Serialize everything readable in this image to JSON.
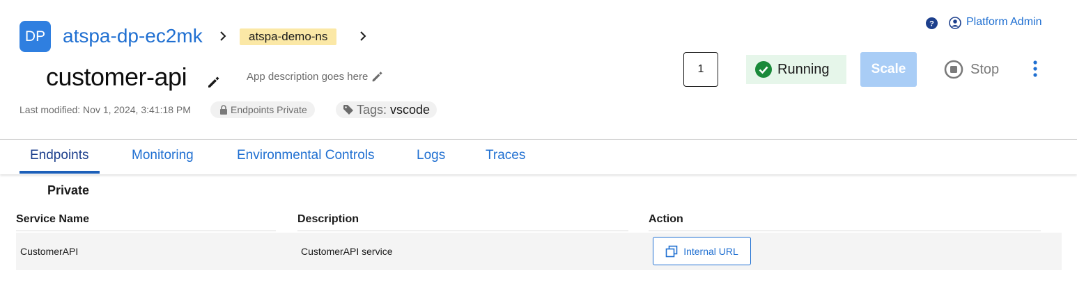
{
  "header": {
    "logo_text": "DP",
    "project_name": "atspa-dp-ec2mk",
    "namespace": "atspa-demo-ns",
    "app_name": "customer-api",
    "app_description": "App description goes here",
    "last_modified": "Last modified: Nov 1, 2024, 3:41:18 PM",
    "endpoints_visibility": "Endpoints Private",
    "tags_label": "Tags:",
    "tags_value": "vscode"
  },
  "user": {
    "name": "Platform Admin"
  },
  "controls": {
    "replicas": "1",
    "status": "Running",
    "scale_label": "Scale",
    "stop_label": "Stop"
  },
  "tabs": [
    {
      "label": "Endpoints",
      "active": true
    },
    {
      "label": "Monitoring",
      "active": false
    },
    {
      "label": "Environmental Controls",
      "active": false
    },
    {
      "label": "Logs",
      "active": false
    },
    {
      "label": "Traces",
      "active": false
    }
  ],
  "endpoints": {
    "section_title": "Private",
    "columns": [
      "Service Name",
      "Description",
      "Action"
    ],
    "rows": [
      {
        "service_name": "CustomerAPI",
        "description": "CustomerAPI service",
        "action_label": "Internal URL"
      }
    ]
  },
  "colors": {
    "brand_blue": "#2f7fe0",
    "link_blue": "#1f6fd1",
    "status_green": "#1a8a3a",
    "status_bg": "#e6f6ea",
    "namespace_bg": "#fbe8a6",
    "scale_disabled": "#a9cdf6"
  },
  "icons": [
    "help-icon",
    "user-circle-icon",
    "pencil-icon",
    "lock-icon",
    "tag-icon",
    "check-circle-icon",
    "stop-circle-icon",
    "kebab-menu-icon",
    "copy-icon",
    "chevron-right-icon"
  ]
}
